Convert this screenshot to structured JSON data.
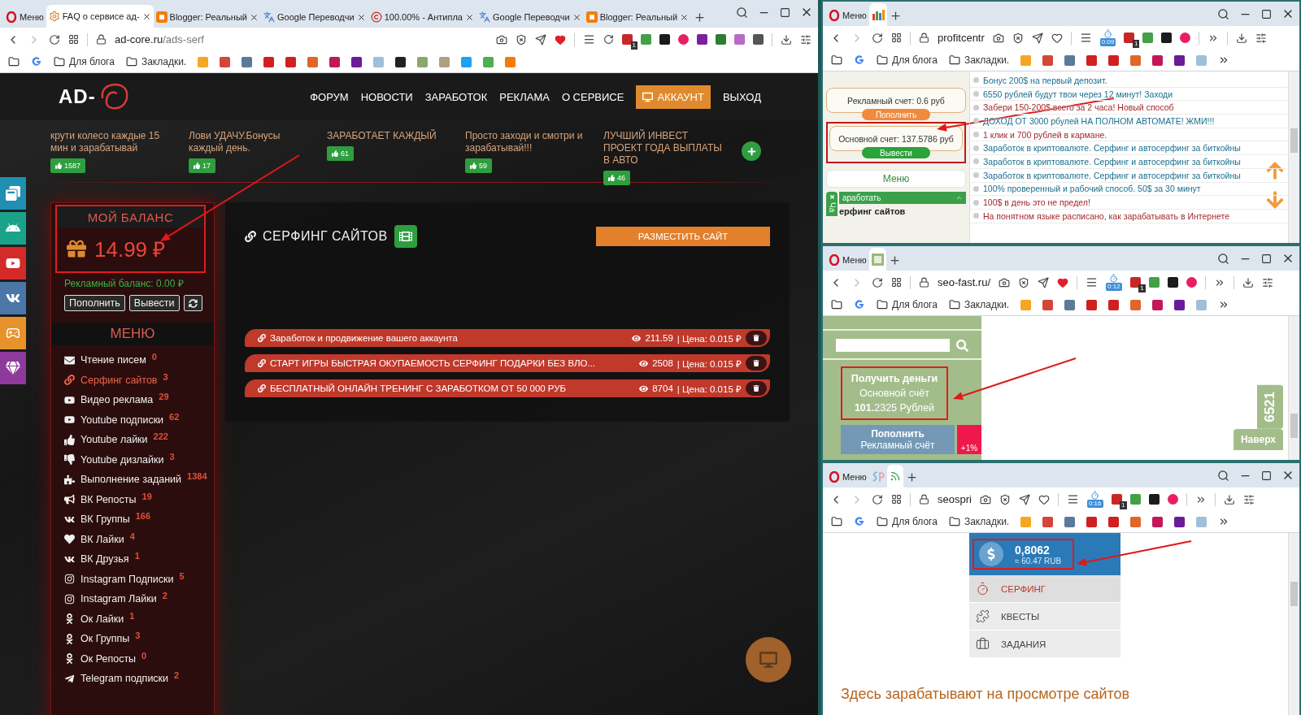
{
  "left_window": {
    "tabs": [
      {
        "kind": "menu",
        "label": "Меню",
        "selected": false
      },
      {
        "kind": "gear",
        "label": "FAQ о сервисе ад-",
        "selected": true
      },
      {
        "kind": "blogger",
        "label": "Blogger: Реальный",
        "selected": false
      },
      {
        "kind": "translate",
        "label": "Google Переводчи",
        "selected": false
      },
      {
        "kind": "copyright",
        "label": "100.00% - Антипла",
        "selected": false
      },
      {
        "kind": "translate",
        "label": "Google Переводчи",
        "selected": false
      },
      {
        "kind": "blogger",
        "label": "Blogger: Реальный",
        "selected": false
      }
    ],
    "toolbar": {
      "host": "ad-core.ru",
      "path": "/ads-serf",
      "favorite": true,
      "badge": "1"
    },
    "bookmarks": {
      "folders": [
        "Для блога",
        "Закладки."
      ]
    },
    "page": {
      "logo": "AD-",
      "nav": [
        {
          "label": "ФОРУМ",
          "selected": false
        },
        {
          "label": "НОВОСТИ",
          "selected": false
        },
        {
          "label": "ЗАРАБОТОК",
          "selected": false
        },
        {
          "label": "РЕКЛАМА",
          "selected": false
        },
        {
          "label": "О СЕРВИСЕ",
          "selected": false
        },
        {
          "label": "АККАУНТ",
          "selected": true
        },
        {
          "label": "ВЫХОД",
          "selected": false
        }
      ],
      "promos": [
        {
          "text": "крути колесо каждые 15 мин и зарабатывай",
          "count": "1587"
        },
        {
          "text": "Лови УДАЧУ.Бонусы каждый день.",
          "count": "17"
        },
        {
          "text": "ЗАРАБОТАЕТ КАЖДЫЙ",
          "count": "61"
        },
        {
          "text": "Просто заходи и смотри и зарабатывай!!!",
          "count": "59"
        },
        {
          "text": "ЛУЧШИЙ ИНВЕСТ ПРОЕКТ ГОДА ВЫПЛАТЫ В АВТО",
          "count": "46"
        }
      ],
      "balance": {
        "title": "МОЙ БАЛАНС",
        "amount": "14.99 ₽",
        "ad_balance": "Рекламный баланс: 0.00 ₽",
        "buttons": [
          "Пополнить",
          "Вывести"
        ]
      },
      "menu": {
        "title": "МЕНЮ",
        "items": [
          {
            "label": "Чтение писем",
            "count": "0",
            "selected": false
          },
          {
            "label": "Серфинг сайтов",
            "count": "3",
            "selected": true
          },
          {
            "label": "Видео реклама",
            "count": "29",
            "selected": false
          },
          {
            "label": "Youtube подписки",
            "count": "62",
            "selected": false
          },
          {
            "label": "Youtube лайки",
            "count": "222",
            "selected": false
          },
          {
            "label": "Youtube дизлайки",
            "count": "3",
            "selected": false
          },
          {
            "label": "Выполнение заданий",
            "count": "1384",
            "selected": false
          },
          {
            "label": "ВК Репосты",
            "count": "19",
            "selected": false
          },
          {
            "label": "ВК Группы",
            "count": "166",
            "selected": false
          },
          {
            "label": "ВК Лайки",
            "count": "4",
            "selected": false
          },
          {
            "label": "ВК Друзья",
            "count": "1",
            "selected": false
          },
          {
            "label": "Instagram Подписки",
            "count": "5",
            "selected": false
          },
          {
            "label": "Instagram Лайки",
            "count": "2",
            "selected": false
          },
          {
            "label": "Ок Лайки",
            "count": "1",
            "selected": false
          },
          {
            "label": "Ок Группы",
            "count": "3",
            "selected": false
          },
          {
            "label": "Ок Репосты",
            "count": "0",
            "selected": false
          },
          {
            "label": "Telegram подписки",
            "count": "2",
            "selected": false
          }
        ]
      },
      "surfing": {
        "title": "СЕРФИНГ САЙТОВ",
        "button": "РАЗМЕСТИТЬ САЙТ",
        "ads": [
          {
            "title": "Заработок и продвижение вашего аккаунта",
            "views": "211.59",
            "price": "| Цена: 0.015 ₽"
          },
          {
            "title": "СТАРТ ИГРЫ БЫСТРАЯ ОКУПАЕМОСТЬ СЕРФИНГ ПОДАРКИ БЕЗ ВЛО...",
            "views": "2508",
            "price": "| Цена: 0.015 ₽"
          },
          {
            "title": "БЕСПЛАТНЫЙ ОНЛАЙН ТРЕНИНГ С ЗАРАБОТКОМ ОТ 50 000 РУБ",
            "views": "8704",
            "price": "| Цена: 0.015 ₽"
          }
        ]
      }
    }
  },
  "top_right_window": {
    "tabs": [
      {
        "kind": "menu",
        "label": "Меню",
        "selected": false
      },
      {
        "kind": "chart",
        "selected": true
      }
    ],
    "toolbar": {
      "host": "profitcentr",
      "favorite": false,
      "timer": "0:09",
      "badge": "1"
    },
    "bookmarks": {
      "folders": [
        "Для блога",
        "Закладки."
      ]
    },
    "page": {
      "ad_account": "Рекламный счет: 0.6 руб",
      "top_up_button": "Пополнить",
      "main_account": "Основной счет: 137.5786 руб",
      "withdraw_button": "Вывести",
      "menu_title": "Меню",
      "menu_section": "аработать",
      "menu_item": "ерфинг сайтов",
      "chat_tab": "Ча",
      "links": [
        {
          "text": "Бонус 200$ на первый депозит.",
          "color": "#1b6f8c"
        },
        {
          "text": "6550 рублей будут твои через 12 минут! Заходи",
          "color": "#1b6f8c"
        },
        {
          "text": "Забери 150-200$ всего за 2 часа! Новый способ",
          "color": "#a3282b"
        },
        {
          "text": "ДОХОД ОТ 3000 рбулей НА ПОЛНОМ АВТОМАТЕ! ЖМИ!!!",
          "color": "#1b6f8c"
        },
        {
          "text": "1 клик и 700 рублей в кармане.",
          "color": "#a3282b"
        },
        {
          "text": "Заработок в криптовалюте. Серфинг и автосерфинг за биткойны",
          "color": "#1b6f8c"
        },
        {
          "text": "Заработок в криптовалюте. Серфинг и автосерфинг за биткойны",
          "color": "#1b6f8c"
        },
        {
          "text": "Заработок в криптовалюте. Серфинг и автосерфинг за биткойны",
          "color": "#1b6f8c"
        },
        {
          "text": "100% проверенный и рабочий способ. 50$ за 30 минут",
          "color": "#1b6f8c"
        },
        {
          "text": "100$ в день это не предел!",
          "color": "#a3282b"
        },
        {
          "text": "На понятном языке расписано, как зарабатывать в Интернете",
          "color": "#a3282b"
        }
      ]
    }
  },
  "middle_right_window": {
    "tabs": [
      {
        "kind": "menu",
        "label": "Меню",
        "selected": false
      },
      {
        "kind": "sf",
        "selected": true
      }
    ],
    "toolbar": {
      "host": "seo-fast.ru/",
      "favorite": true,
      "timer": "0:12",
      "badge": "1"
    },
    "bookmarks": {
      "folders": [
        "Для блога",
        "Закладки."
      ]
    },
    "page": {
      "action": "Получить деньги",
      "account_label": "Основной счёт",
      "amount": "**101.**2325 Рублей",
      "top_up": "Пополнить",
      "ad_account": "Рекламный счёт",
      "bonus": "+1%",
      "counter": "6521",
      "top_button": "Наверх"
    }
  },
  "bottom_right_window": {
    "tabs": [
      {
        "kind": "menu",
        "label": "Меню",
        "selected": false
      },
      {
        "kind": "sp",
        "selected": false
      },
      {
        "kind": "wifi",
        "selected": true
      }
    ],
    "toolbar": {
      "host": "seospri",
      "favorite": false,
      "timer": "0:16",
      "badge": "1"
    },
    "bookmarks": {
      "folders": [
        "Для блога",
        "Закладки."
      ]
    },
    "page": {
      "balance": "0,8062",
      "balance_rub": "≈ 60.47 RUB",
      "menu": [
        {
          "label": "СЕРФИНГ",
          "selected": true
        },
        {
          "label": "КВЕСТЫ",
          "selected": false
        },
        {
          "label": "ЗАДАНИЯ",
          "selected": false
        }
      ],
      "tagline": "Здесь зарабатывают на просмотре сайтов"
    }
  }
}
